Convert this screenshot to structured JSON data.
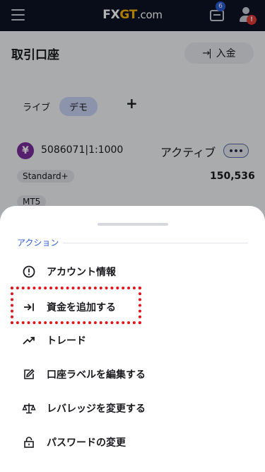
{
  "header": {
    "logo_main": "FX",
    "logo_accent": "GT",
    "logo_domain": ".com",
    "ticket_badge": "6",
    "user_alert": "!"
  },
  "page": {
    "title": "取引口座",
    "deposit_label": "入金",
    "tabs": {
      "live": "ライブ",
      "demo": "デモ",
      "add": "+"
    }
  },
  "account": {
    "icon": "¥",
    "number": "5086071|1:1000",
    "status": "アクティブ",
    "type": "Standard+",
    "balance": "150,536",
    "platform": "MT5"
  },
  "sheet": {
    "section": "アクション",
    "actions": [
      {
        "icon": "info-circle-icon",
        "label": "アカウント情報"
      },
      {
        "icon": "arrow-in-icon",
        "label": "資金を追加する"
      },
      {
        "icon": "trend-up-icon",
        "label": "トレード"
      },
      {
        "icon": "edit-icon",
        "label": "口座ラベルを編集する"
      },
      {
        "icon": "scale-icon",
        "label": "レバレッジを変更する"
      },
      {
        "icon": "lock-icon",
        "label": "パスワードの変更"
      }
    ]
  },
  "colors": {
    "header_bg": "#0e1324",
    "accent_blue": "#2a5bd7",
    "highlight_red": "#e2141a",
    "demo_tab": "#c9d5f5"
  }
}
